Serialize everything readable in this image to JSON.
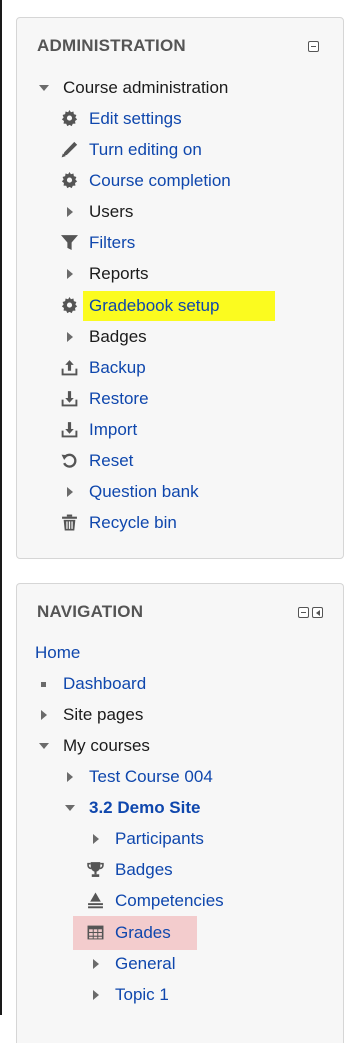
{
  "administration": {
    "title": "ADMINISTRATION",
    "items": [
      {
        "label": "Course administration",
        "icon": "triangle-down-icon"
      },
      {
        "label": "Edit settings",
        "icon": "gear-icon"
      },
      {
        "label": "Turn editing on",
        "icon": "pencil-icon"
      },
      {
        "label": "Course completion",
        "icon": "gear-icon"
      },
      {
        "label": "Users",
        "icon": "triangle-right-icon"
      },
      {
        "label": "Filters",
        "icon": "filter-icon"
      },
      {
        "label": "Reports",
        "icon": "triangle-right-icon"
      },
      {
        "label": "Gradebook setup",
        "icon": "gear-icon",
        "highlight": "#fbfb1f"
      },
      {
        "label": "Badges",
        "icon": "triangle-right-icon"
      },
      {
        "label": "Backup",
        "icon": "upload-icon"
      },
      {
        "label": "Restore",
        "icon": "download-icon"
      },
      {
        "label": "Import",
        "icon": "download-icon"
      },
      {
        "label": "Reset",
        "icon": "reset-icon"
      },
      {
        "label": "Question bank",
        "icon": "triangle-right-icon"
      },
      {
        "label": "Recycle bin",
        "icon": "trash-icon"
      }
    ]
  },
  "navigation": {
    "title": "NAVIGATION",
    "items": [
      {
        "label": "Home"
      },
      {
        "label": "Dashboard",
        "icon": "bullet-icon"
      },
      {
        "label": "Site pages",
        "icon": "triangle-right-icon"
      },
      {
        "label": "My courses",
        "icon": "triangle-down-icon"
      },
      {
        "label": "Test Course 004",
        "icon": "triangle-right-icon"
      },
      {
        "label": "3.2 Demo Site",
        "icon": "triangle-down-icon"
      },
      {
        "label": "Participants",
        "icon": "triangle-right-icon"
      },
      {
        "label": "Badges",
        "icon": "trophy-icon"
      },
      {
        "label": "Competencies",
        "icon": "competencies-icon"
      },
      {
        "label": "Grades",
        "icon": "grades-table-icon",
        "highlight": "#f3cccd"
      },
      {
        "label": "General",
        "icon": "triangle-right-icon"
      },
      {
        "label": "Topic 1",
        "icon": "triangle-right-icon"
      }
    ]
  },
  "colors": {
    "link": "#0f47ad",
    "text": "#1b1b1b",
    "block_bg": "#f7f7f7",
    "icon": "#555555"
  }
}
